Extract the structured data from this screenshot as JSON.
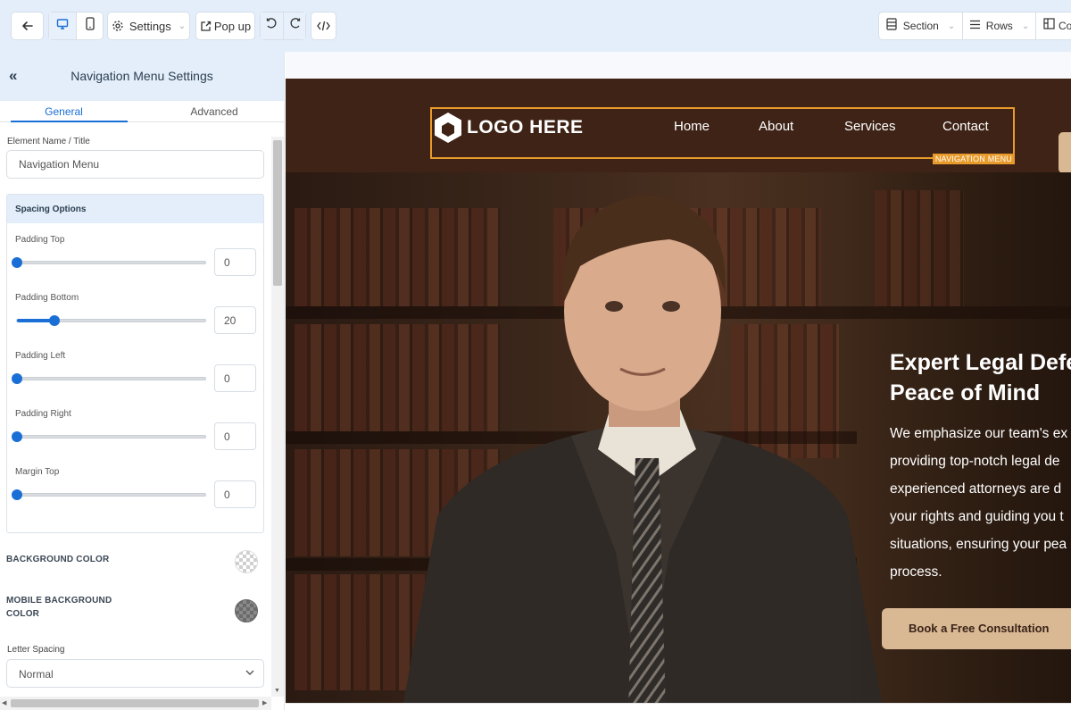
{
  "toolbar": {
    "settings_label": "Settings",
    "popup_label": "Pop up",
    "section_label": "Section",
    "rows_label": "Rows",
    "cols_label": "Co"
  },
  "panel": {
    "title": "Navigation Menu Settings",
    "tabs": [
      "General",
      "Advanced"
    ],
    "element_name_label": "Element Name / Title",
    "element_name_value": "Navigation Menu",
    "spacing": {
      "header": "Spacing Options",
      "rows": [
        {
          "label": "Padding Top",
          "value": "0",
          "fraction": 0
        },
        {
          "label": "Padding Bottom",
          "value": "20",
          "fraction": 0.2
        },
        {
          "label": "Padding Left",
          "value": "0",
          "fraction": 0
        },
        {
          "label": "Padding Right",
          "value": "0",
          "fraction": 0
        },
        {
          "label": "Margin Top",
          "value": "0",
          "fraction": 0
        }
      ]
    },
    "background_color_label": "BACKGROUND COLOR",
    "mobile_background_color_label_1": "MOBILE BACKGROUND",
    "mobile_background_color_label_2": "COLOR",
    "letter_spacing_label": "Letter Spacing",
    "letter_spacing_value": "Normal"
  },
  "site": {
    "logo_text": "LOGO HERE",
    "nav_links": [
      "Home",
      "About",
      "Services",
      "Contact"
    ],
    "selected_tag": "NAVIGATION MENU",
    "hero_title_1": "Expert Legal Defe",
    "hero_title_2": "Peace of Mind",
    "hero_lines": [
      "We emphasize our team's ex",
      "providing top-notch legal de",
      "experienced attorneys are d",
      "your rights and guiding you t",
      "situations, ensuring your pea",
      "process."
    ],
    "cta_label": "Book a Free Consultation"
  },
  "colors": {
    "accent": "#1a6fd6",
    "selection": "#e89b2a",
    "nav_bg": "#3e2316",
    "cta_bg": "#d9b894"
  }
}
